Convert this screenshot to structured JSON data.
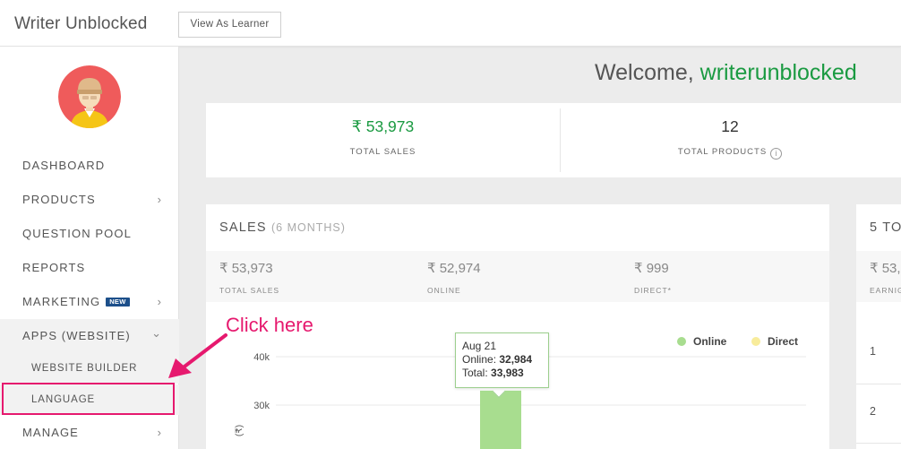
{
  "header": {
    "brand": "Writer Unblocked",
    "view_as_learner": "View As Learner"
  },
  "sidebar": {
    "items": [
      {
        "label": "DASHBOARD"
      },
      {
        "label": "PRODUCTS",
        "chevron": "›"
      },
      {
        "label": "QUESTION POOL"
      },
      {
        "label": "REPORTS"
      },
      {
        "label": "MARKETING",
        "badge": "NEW",
        "chevron": "›"
      },
      {
        "label": "APPS (WEBSITE)",
        "chevron": "⌄"
      },
      {
        "label": "MANAGE",
        "chevron": "›"
      }
    ],
    "subitems": [
      {
        "label": "WEBSITE BUILDER"
      },
      {
        "label": "LANGUAGE"
      }
    ]
  },
  "welcome": {
    "prefix": "Welcome, ",
    "username": "writerunblocked"
  },
  "stats": {
    "total_sales": {
      "value": "₹ 53,973",
      "label": "TOTAL SALES"
    },
    "total_products": {
      "value": "12",
      "label": "TOTAL PRODUCTS",
      "info_icon": "i"
    }
  },
  "sales_card": {
    "title": "SALES",
    "period": "(6 MONTHS)",
    "summary": [
      {
        "value": "₹ 53,973",
        "label": "TOTAL SALES"
      },
      {
        "value": "₹ 52,974",
        "label": "ONLINE"
      },
      {
        "value": "₹ 999",
        "label": "DIRECT*"
      }
    ]
  },
  "top5_card": {
    "title": "5 TO",
    "value": "₹ 53,",
    "label": "EARNIG",
    "rows": [
      "1",
      "2"
    ]
  },
  "tooltip": {
    "date": "Aug 21",
    "online_label": "Online: ",
    "online_value": "32,984",
    "total_label": "Total: ",
    "total_value": "33,983"
  },
  "annotation": {
    "callout": "Click here"
  },
  "colors": {
    "online": "#a8dd8f",
    "direct": "#f8ec9b",
    "accent_green": "#1a9a41",
    "annotation": "#e6196e",
    "badge": "#1c4f8a"
  },
  "chart_data": {
    "type": "bar",
    "ylim": [
      25000,
      45000
    ],
    "yticks": [
      40000,
      30000
    ],
    "ytick_labels": [
      "40k",
      "30k"
    ],
    "ylabel": "(₹)",
    "series": [
      {
        "name": "Online",
        "values": [
          32984
        ]
      },
      {
        "name": "Direct",
        "values": [
          999
        ]
      }
    ],
    "categories": [
      "Aug 21"
    ]
  }
}
